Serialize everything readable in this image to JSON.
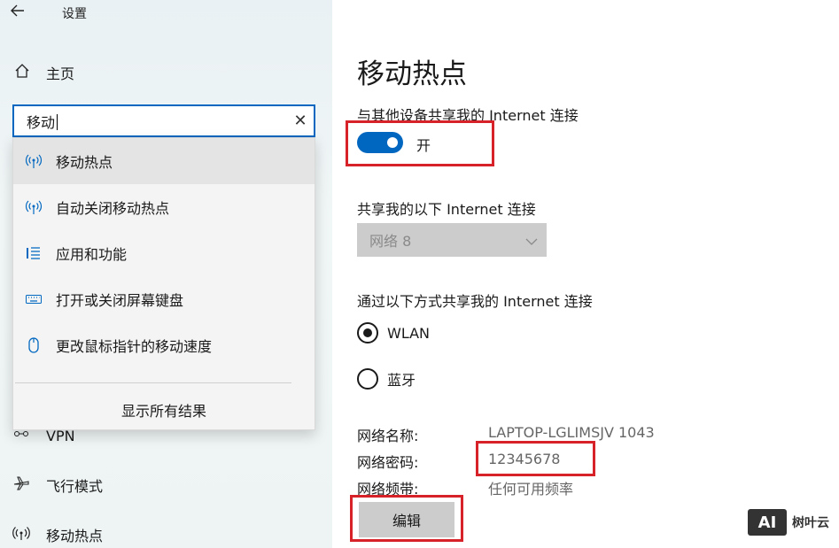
{
  "window": {
    "title": "设置"
  },
  "sidebar": {
    "home_label": "主页",
    "nav_items": [
      {
        "label": "VPN",
        "icon": "vpn-icon"
      },
      {
        "label": "飞行模式",
        "icon": "airplane-icon"
      },
      {
        "label": "移动热点",
        "icon": "hotspot-icon"
      }
    ]
  },
  "search": {
    "value": "移动",
    "results": [
      {
        "label": "移动热点",
        "icon": "hotspot-icon"
      },
      {
        "label": "自动关闭移动热点",
        "icon": "hotspot-icon"
      },
      {
        "label": "应用和功能",
        "icon": "list-icon"
      },
      {
        "label": "打开或关闭屏幕键盘",
        "icon": "keyboard-icon"
      },
      {
        "label": "更改鼠标指针的移动速度",
        "icon": "mouse-icon"
      }
    ],
    "show_all_label": "显示所有结果"
  },
  "main": {
    "title": "移动热点",
    "share_label": "与其他设备共享我的 Internet 连接",
    "toggle_state": "开",
    "share_from_label": "共享我的以下 Internet 连接",
    "share_from_value": "网络 8",
    "share_via_label": "通过以下方式共享我的 Internet 连接",
    "radio_options": [
      {
        "label": "WLAN",
        "selected": true
      },
      {
        "label": "蓝牙",
        "selected": false
      }
    ],
    "network_name_key": "网络名称:",
    "network_name_value": "LAPTOP-LGLIMSJV 1043",
    "network_password_key": "网络密码:",
    "network_password_value": "12345678",
    "network_band_key": "网络频带:",
    "network_band_value": "任何可用频率",
    "edit_label": "编辑"
  },
  "watermark": {
    "logo": "AI",
    "text": "树叶云"
  },
  "colors": {
    "accent": "#0067c0",
    "highlight": "#d8222a",
    "disabled": "#cccccc"
  }
}
